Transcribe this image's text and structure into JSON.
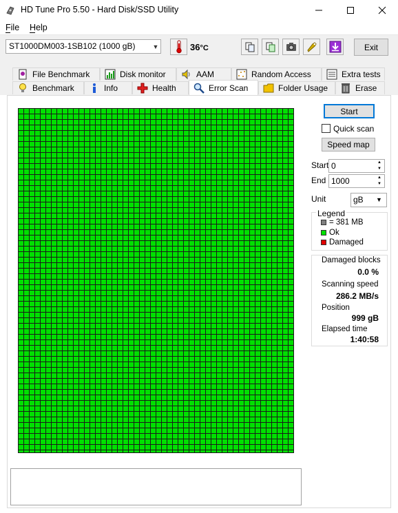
{
  "window": {
    "title": "HD Tune Pro 5.50 - Hard Disk/SSD Utility"
  },
  "menu": {
    "file": "File",
    "help": "Help"
  },
  "toolbar": {
    "drive": "ST1000DM003-1SB102 (1000 gB)",
    "temperature": "36",
    "temperature_unit": "°C",
    "exit_label": "Exit"
  },
  "tabs": {
    "top_row": [
      {
        "label": "File Benchmark",
        "icon": "file-benchmark-icon"
      },
      {
        "label": "Disk monitor",
        "icon": "disk-monitor-icon"
      },
      {
        "label": "AAM",
        "icon": "speaker-icon"
      },
      {
        "label": "Random Access",
        "icon": "random-access-icon"
      },
      {
        "label": "Extra tests",
        "icon": "extra-tests-icon"
      }
    ],
    "bottom_row": [
      {
        "label": "Benchmark",
        "icon": "bulb-icon"
      },
      {
        "label": "Info",
        "icon": "info-icon"
      },
      {
        "label": "Health",
        "icon": "health-cross-icon"
      },
      {
        "label": "Error Scan",
        "icon": "magnifier-icon",
        "active": true
      },
      {
        "label": "Folder Usage",
        "icon": "folder-icon"
      },
      {
        "label": "Erase",
        "icon": "erase-icon"
      }
    ]
  },
  "controls": {
    "start_label": "Start",
    "quick_scan_label": "Quick scan",
    "quick_scan_checked": false,
    "speed_map_label": "Speed map",
    "start_field_label": "Start",
    "start_value": "0",
    "end_field_label": "End",
    "end_value": "1000",
    "unit_label": "Unit",
    "unit_value": "gB"
  },
  "legend": {
    "title": "Legend",
    "items": [
      {
        "label": "= 381 MB",
        "color": "#808080"
      },
      {
        "label": "Ok",
        "color": "#00e000"
      },
      {
        "label": "Damaged",
        "color": "#e00000"
      }
    ]
  },
  "stats": {
    "damaged_label": "Damaged blocks",
    "damaged_value": "0.0",
    "damaged_unit": "%",
    "speed_label": "Scanning speed",
    "speed_value": "286.2 MB/s",
    "position_label": "Position",
    "position_value": "999 gB",
    "elapsed_label": "Elapsed time",
    "elapsed_value": "1:40:58"
  },
  "colors": {
    "ok_block": "#00e000",
    "accent": "#0078d7"
  }
}
